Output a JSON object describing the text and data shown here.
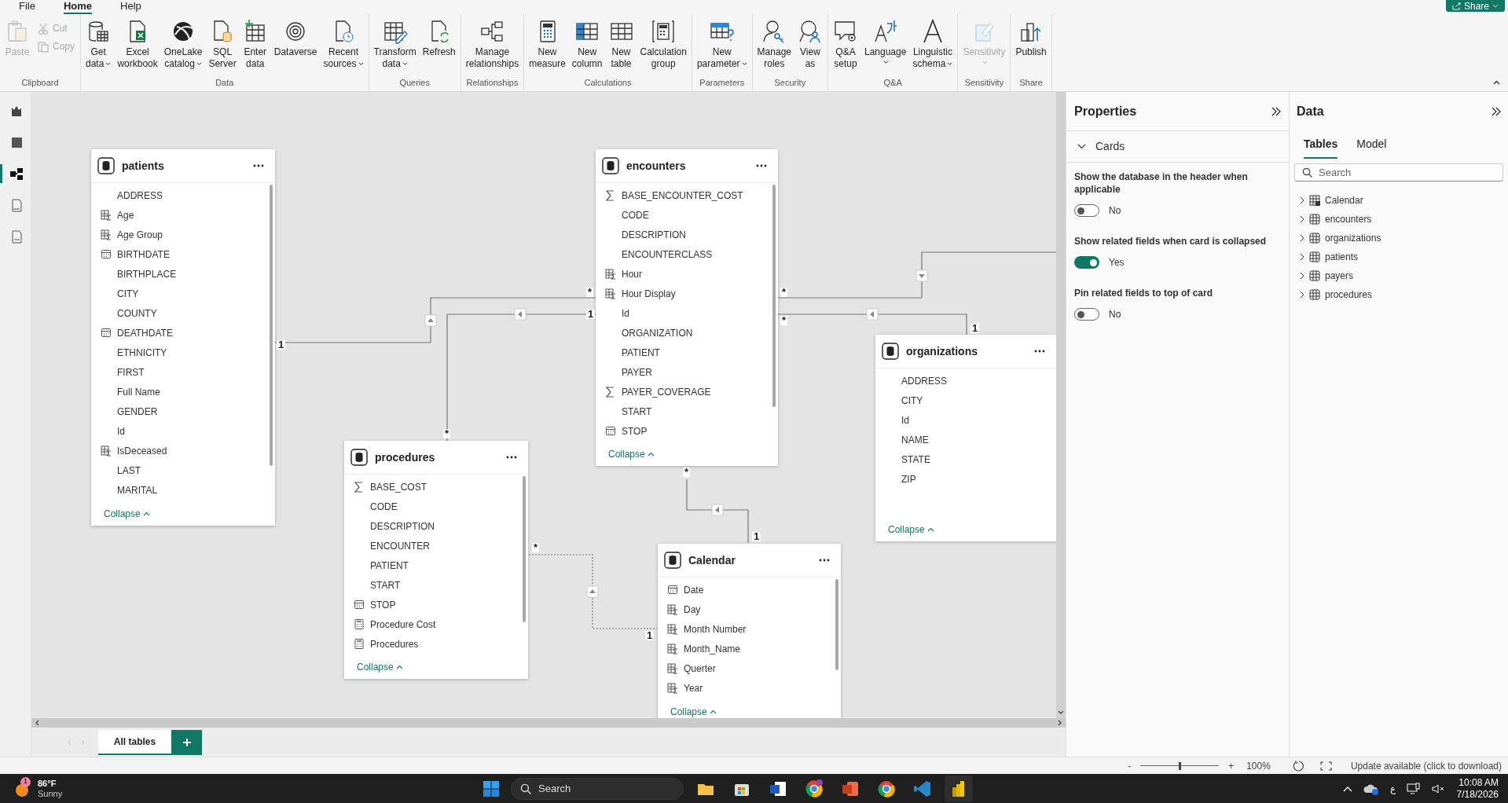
{
  "ribbon": {
    "tabs": [
      {
        "label": "File",
        "selected": false
      },
      {
        "label": "Home",
        "selected": true
      },
      {
        "label": "Help",
        "selected": false
      }
    ],
    "share_button": {
      "label": "Share"
    },
    "groups": [
      {
        "label": "Clipboard",
        "buttons": [
          {
            "label": "Paste",
            "kind": "large",
            "menu": false,
            "disabled": true
          },
          {
            "label": "Cut",
            "kind": "small",
            "menu": false,
            "disabled": true
          },
          {
            "label": "Copy",
            "kind": "small",
            "menu": false,
            "disabled": true
          }
        ]
      },
      {
        "label": "Data",
        "buttons": [
          {
            "label": "Get\ndata",
            "kind": "large",
            "menu": true,
            "disabled": false
          },
          {
            "label": "Excel\nworkbook",
            "kind": "large",
            "menu": false,
            "disabled": false
          },
          {
            "label": "OneLake\ncatalog",
            "kind": "large",
            "menu": true,
            "disabled": false
          },
          {
            "label": "SQL\nServer",
            "kind": "large",
            "menu": false,
            "disabled": false
          },
          {
            "label": "Enter\ndata",
            "kind": "large",
            "menu": false,
            "disabled": false
          },
          {
            "label": "Dataverse",
            "kind": "large",
            "menu": false,
            "disabled": false
          },
          {
            "label": "Recent\nsources",
            "kind": "large",
            "menu": true,
            "disabled": false
          }
        ]
      },
      {
        "label": "Queries",
        "buttons": [
          {
            "label": "Transform\ndata",
            "kind": "large",
            "menu": true,
            "disabled": false
          },
          {
            "label": "Refresh",
            "kind": "large",
            "menu": false,
            "disabled": false
          }
        ]
      },
      {
        "label": "Relationships",
        "buttons": [
          {
            "label": "Manage\nrelationships",
            "kind": "large",
            "menu": false,
            "disabled": false
          }
        ]
      },
      {
        "label": "Calculations",
        "buttons": [
          {
            "label": "New\nmeasure",
            "kind": "large",
            "menu": false,
            "disabled": false
          },
          {
            "label": "New\ncolumn",
            "kind": "large",
            "menu": false,
            "disabled": false
          },
          {
            "label": "New\ntable",
            "kind": "large",
            "menu": false,
            "disabled": false
          },
          {
            "label": "Calculation\ngroup",
            "kind": "large",
            "menu": false,
            "disabled": false
          }
        ]
      },
      {
        "label": "Parameters",
        "buttons": [
          {
            "label": "New\nparameter",
            "kind": "large",
            "menu": true,
            "disabled": false
          }
        ]
      },
      {
        "label": "Security",
        "buttons": [
          {
            "label": "Manage\nroles",
            "kind": "large",
            "menu": false,
            "disabled": false
          },
          {
            "label": "View\nas",
            "kind": "large",
            "menu": false,
            "disabled": false
          }
        ]
      },
      {
        "label": "Q&A",
        "buttons": [
          {
            "label": "Q&A\nsetup",
            "kind": "large",
            "menu": false,
            "disabled": false
          },
          {
            "label": "Language",
            "kind": "large",
            "menu": true,
            "disabled": false
          },
          {
            "label": "Linguistic\nschema",
            "kind": "large",
            "menu": true,
            "disabled": false
          }
        ]
      },
      {
        "label": "Sensitivity",
        "buttons": [
          {
            "label": "Sensitivity",
            "kind": "large",
            "menu": true,
            "disabled": true
          }
        ]
      },
      {
        "label": "Share",
        "buttons": [
          {
            "label": "Publish",
            "kind": "large",
            "menu": false,
            "disabled": false
          }
        ]
      }
    ]
  },
  "views": [
    {
      "selected": false
    },
    {
      "selected": false
    },
    {
      "selected": true
    },
    {
      "selected": false
    },
    {
      "selected": false
    }
  ],
  "cards": [
    {
      "title": "patients",
      "collapse_label": "Collapse",
      "fields": [
        {
          "name": "ADDRESS",
          "kind": "plain"
        },
        {
          "name": "Age",
          "kind": "calc"
        },
        {
          "name": "Age Group",
          "kind": "calc"
        },
        {
          "name": "BIRTHDATE",
          "kind": "date"
        },
        {
          "name": "BIRTHPLACE",
          "kind": "plain"
        },
        {
          "name": "CITY",
          "kind": "plain"
        },
        {
          "name": "COUNTY",
          "kind": "plain"
        },
        {
          "name": "DEATHDATE",
          "kind": "date"
        },
        {
          "name": "ETHNICITY",
          "kind": "plain"
        },
        {
          "name": "FIRST",
          "kind": "plain"
        },
        {
          "name": "Full Name",
          "kind": "plain"
        },
        {
          "name": "GENDER",
          "kind": "plain"
        },
        {
          "name": "Id",
          "kind": "plain"
        },
        {
          "name": "IsDeceased",
          "kind": "calc"
        },
        {
          "name": "LAST",
          "kind": "plain"
        },
        {
          "name": "MARITAL",
          "kind": "plain"
        }
      ]
    },
    {
      "title": "encounters",
      "collapse_label": "Collapse",
      "fields": [
        {
          "name": "BASE_ENCOUNTER_COST",
          "kind": "sum"
        },
        {
          "name": "CODE",
          "kind": "plain"
        },
        {
          "name": "DESCRIPTION",
          "kind": "plain"
        },
        {
          "name": "ENCOUNTERCLASS",
          "kind": "plain"
        },
        {
          "name": "Hour",
          "kind": "calc"
        },
        {
          "name": "Hour Display",
          "kind": "calc"
        },
        {
          "name": "Id",
          "kind": "plain"
        },
        {
          "name": "ORGANIZATION",
          "kind": "plain"
        },
        {
          "name": "PATIENT",
          "kind": "plain"
        },
        {
          "name": "PAYER",
          "kind": "plain"
        },
        {
          "name": "PAYER_COVERAGE",
          "kind": "sum"
        },
        {
          "name": "START",
          "kind": "plain"
        },
        {
          "name": "STOP",
          "kind": "date"
        }
      ]
    },
    {
      "title": "organizations",
      "collapse_label": "Collapse",
      "fields": [
        {
          "name": "ADDRESS",
          "kind": "plain"
        },
        {
          "name": "CITY",
          "kind": "plain"
        },
        {
          "name": "Id",
          "kind": "plain"
        },
        {
          "name": "NAME",
          "kind": "plain"
        },
        {
          "name": "STATE",
          "kind": "plain"
        },
        {
          "name": "ZIP",
          "kind": "plain"
        }
      ]
    },
    {
      "title": "procedures",
      "collapse_label": "Collapse",
      "fields": [
        {
          "name": "BASE_COST",
          "kind": "sum"
        },
        {
          "name": "CODE",
          "kind": "plain"
        },
        {
          "name": "DESCRIPTION",
          "kind": "plain"
        },
        {
          "name": "ENCOUNTER",
          "kind": "plain"
        },
        {
          "name": "PATIENT",
          "kind": "plain"
        },
        {
          "name": "START",
          "kind": "plain"
        },
        {
          "name": "STOP",
          "kind": "date"
        },
        {
          "name": "Procedure Cost",
          "kind": "measure"
        },
        {
          "name": "Procedures",
          "kind": "measure"
        }
      ]
    },
    {
      "title": "Calendar",
      "collapse_label": "Collapse",
      "fields": [
        {
          "name": "Date",
          "kind": "date"
        },
        {
          "name": "Day",
          "kind": "calc"
        },
        {
          "name": "Month Number",
          "kind": "calc"
        },
        {
          "name": "Month_Name",
          "kind": "calc"
        },
        {
          "name": "Querter",
          "kind": "calc"
        },
        {
          "name": "Year",
          "kind": "calc"
        }
      ]
    }
  ],
  "relationships": [
    {
      "end_a": "1",
      "end_b": "*",
      "inactive": false
    },
    {
      "end_a": "*",
      "end_b": "1",
      "inactive": false
    },
    {
      "end_a": "*",
      "inactive": false
    },
    {
      "end_a": "*",
      "end_b": "1",
      "inactive": false
    },
    {
      "end_a": "*",
      "end_b": "1",
      "inactive": false
    },
    {
      "end_a": "*",
      "end_b": "1",
      "inactive": true
    }
  ],
  "layout_tabs": [
    {
      "label": "All tables",
      "selected": true
    }
  ],
  "properties": {
    "title": "Properties",
    "section": {
      "label": "Cards",
      "expanded": true
    },
    "settings": [
      {
        "label": "Show the database in the header when applicable",
        "on": false,
        "value": "No"
      },
      {
        "label": "Show related fields when card is collapsed",
        "on": true,
        "value": "Yes"
      },
      {
        "label": "Pin related fields to top of card",
        "on": false,
        "value": "No"
      }
    ]
  },
  "data_pane": {
    "title": "Data",
    "tabs": [
      {
        "label": "Tables",
        "selected": true
      },
      {
        "label": "Model",
        "selected": false
      }
    ],
    "search": {
      "placeholder": "Search"
    },
    "tables": [
      {
        "name": "Calendar",
        "kind": "calendar",
        "expanded": false
      },
      {
        "name": "encounters",
        "kind": "table",
        "expanded": false
      },
      {
        "name": "organizations",
        "kind": "table",
        "expanded": false
      },
      {
        "name": "patients",
        "kind": "table",
        "expanded": false
      },
      {
        "name": "payers",
        "kind": "table",
        "expanded": false
      },
      {
        "name": "procedures",
        "kind": "table",
        "expanded": false
      }
    ]
  },
  "status_bar": {
    "zoom_out": "-",
    "zoom_in": "+",
    "zoom": {
      "level": 0.5
    },
    "zoom_label": "100%",
    "update": "Update available (click to download)"
  },
  "taskbar": {
    "weather": {
      "badge": "1",
      "temperature": "86°F",
      "condition": "Sunny"
    },
    "search": {
      "placeholder": "Search"
    },
    "language": "ع",
    "time": "10:08 AM",
    "date": "7/18/2026"
  }
}
